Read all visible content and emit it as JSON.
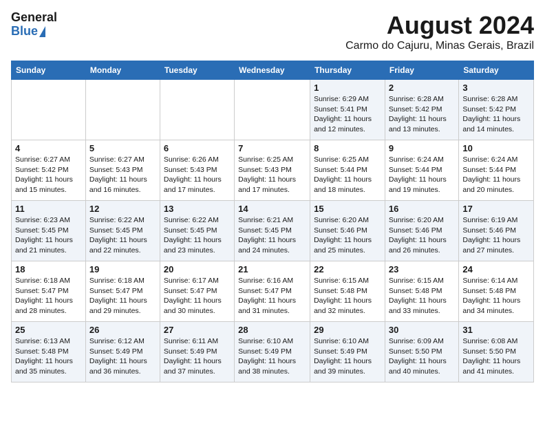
{
  "header": {
    "logo_general": "General",
    "logo_blue": "Blue",
    "title": "August 2024",
    "subtitle": "Carmo do Cajuru, Minas Gerais, Brazil"
  },
  "weekdays": [
    "Sunday",
    "Monday",
    "Tuesday",
    "Wednesday",
    "Thursday",
    "Friday",
    "Saturday"
  ],
  "weeks": [
    [
      {
        "day": "",
        "info": ""
      },
      {
        "day": "",
        "info": ""
      },
      {
        "day": "",
        "info": ""
      },
      {
        "day": "",
        "info": ""
      },
      {
        "day": "1",
        "info": "Sunrise: 6:29 AM\nSunset: 5:41 PM\nDaylight: 11 hours\nand 12 minutes."
      },
      {
        "day": "2",
        "info": "Sunrise: 6:28 AM\nSunset: 5:42 PM\nDaylight: 11 hours\nand 13 minutes."
      },
      {
        "day": "3",
        "info": "Sunrise: 6:28 AM\nSunset: 5:42 PM\nDaylight: 11 hours\nand 14 minutes."
      }
    ],
    [
      {
        "day": "4",
        "info": "Sunrise: 6:27 AM\nSunset: 5:42 PM\nDaylight: 11 hours\nand 15 minutes."
      },
      {
        "day": "5",
        "info": "Sunrise: 6:27 AM\nSunset: 5:43 PM\nDaylight: 11 hours\nand 16 minutes."
      },
      {
        "day": "6",
        "info": "Sunrise: 6:26 AM\nSunset: 5:43 PM\nDaylight: 11 hours\nand 17 minutes."
      },
      {
        "day": "7",
        "info": "Sunrise: 6:25 AM\nSunset: 5:43 PM\nDaylight: 11 hours\nand 17 minutes."
      },
      {
        "day": "8",
        "info": "Sunrise: 6:25 AM\nSunset: 5:44 PM\nDaylight: 11 hours\nand 18 minutes."
      },
      {
        "day": "9",
        "info": "Sunrise: 6:24 AM\nSunset: 5:44 PM\nDaylight: 11 hours\nand 19 minutes."
      },
      {
        "day": "10",
        "info": "Sunrise: 6:24 AM\nSunset: 5:44 PM\nDaylight: 11 hours\nand 20 minutes."
      }
    ],
    [
      {
        "day": "11",
        "info": "Sunrise: 6:23 AM\nSunset: 5:45 PM\nDaylight: 11 hours\nand 21 minutes."
      },
      {
        "day": "12",
        "info": "Sunrise: 6:22 AM\nSunset: 5:45 PM\nDaylight: 11 hours\nand 22 minutes."
      },
      {
        "day": "13",
        "info": "Sunrise: 6:22 AM\nSunset: 5:45 PM\nDaylight: 11 hours\nand 23 minutes."
      },
      {
        "day": "14",
        "info": "Sunrise: 6:21 AM\nSunset: 5:45 PM\nDaylight: 11 hours\nand 24 minutes."
      },
      {
        "day": "15",
        "info": "Sunrise: 6:20 AM\nSunset: 5:46 PM\nDaylight: 11 hours\nand 25 minutes."
      },
      {
        "day": "16",
        "info": "Sunrise: 6:20 AM\nSunset: 5:46 PM\nDaylight: 11 hours\nand 26 minutes."
      },
      {
        "day": "17",
        "info": "Sunrise: 6:19 AM\nSunset: 5:46 PM\nDaylight: 11 hours\nand 27 minutes."
      }
    ],
    [
      {
        "day": "18",
        "info": "Sunrise: 6:18 AM\nSunset: 5:47 PM\nDaylight: 11 hours\nand 28 minutes."
      },
      {
        "day": "19",
        "info": "Sunrise: 6:18 AM\nSunset: 5:47 PM\nDaylight: 11 hours\nand 29 minutes."
      },
      {
        "day": "20",
        "info": "Sunrise: 6:17 AM\nSunset: 5:47 PM\nDaylight: 11 hours\nand 30 minutes."
      },
      {
        "day": "21",
        "info": "Sunrise: 6:16 AM\nSunset: 5:47 PM\nDaylight: 11 hours\nand 31 minutes."
      },
      {
        "day": "22",
        "info": "Sunrise: 6:15 AM\nSunset: 5:48 PM\nDaylight: 11 hours\nand 32 minutes."
      },
      {
        "day": "23",
        "info": "Sunrise: 6:15 AM\nSunset: 5:48 PM\nDaylight: 11 hours\nand 33 minutes."
      },
      {
        "day": "24",
        "info": "Sunrise: 6:14 AM\nSunset: 5:48 PM\nDaylight: 11 hours\nand 34 minutes."
      }
    ],
    [
      {
        "day": "25",
        "info": "Sunrise: 6:13 AM\nSunset: 5:48 PM\nDaylight: 11 hours\nand 35 minutes."
      },
      {
        "day": "26",
        "info": "Sunrise: 6:12 AM\nSunset: 5:49 PM\nDaylight: 11 hours\nand 36 minutes."
      },
      {
        "day": "27",
        "info": "Sunrise: 6:11 AM\nSunset: 5:49 PM\nDaylight: 11 hours\nand 37 minutes."
      },
      {
        "day": "28",
        "info": "Sunrise: 6:10 AM\nSunset: 5:49 PM\nDaylight: 11 hours\nand 38 minutes."
      },
      {
        "day": "29",
        "info": "Sunrise: 6:10 AM\nSunset: 5:49 PM\nDaylight: 11 hours\nand 39 minutes."
      },
      {
        "day": "30",
        "info": "Sunrise: 6:09 AM\nSunset: 5:50 PM\nDaylight: 11 hours\nand 40 minutes."
      },
      {
        "day": "31",
        "info": "Sunrise: 6:08 AM\nSunset: 5:50 PM\nDaylight: 11 hours\nand 41 minutes."
      }
    ]
  ]
}
